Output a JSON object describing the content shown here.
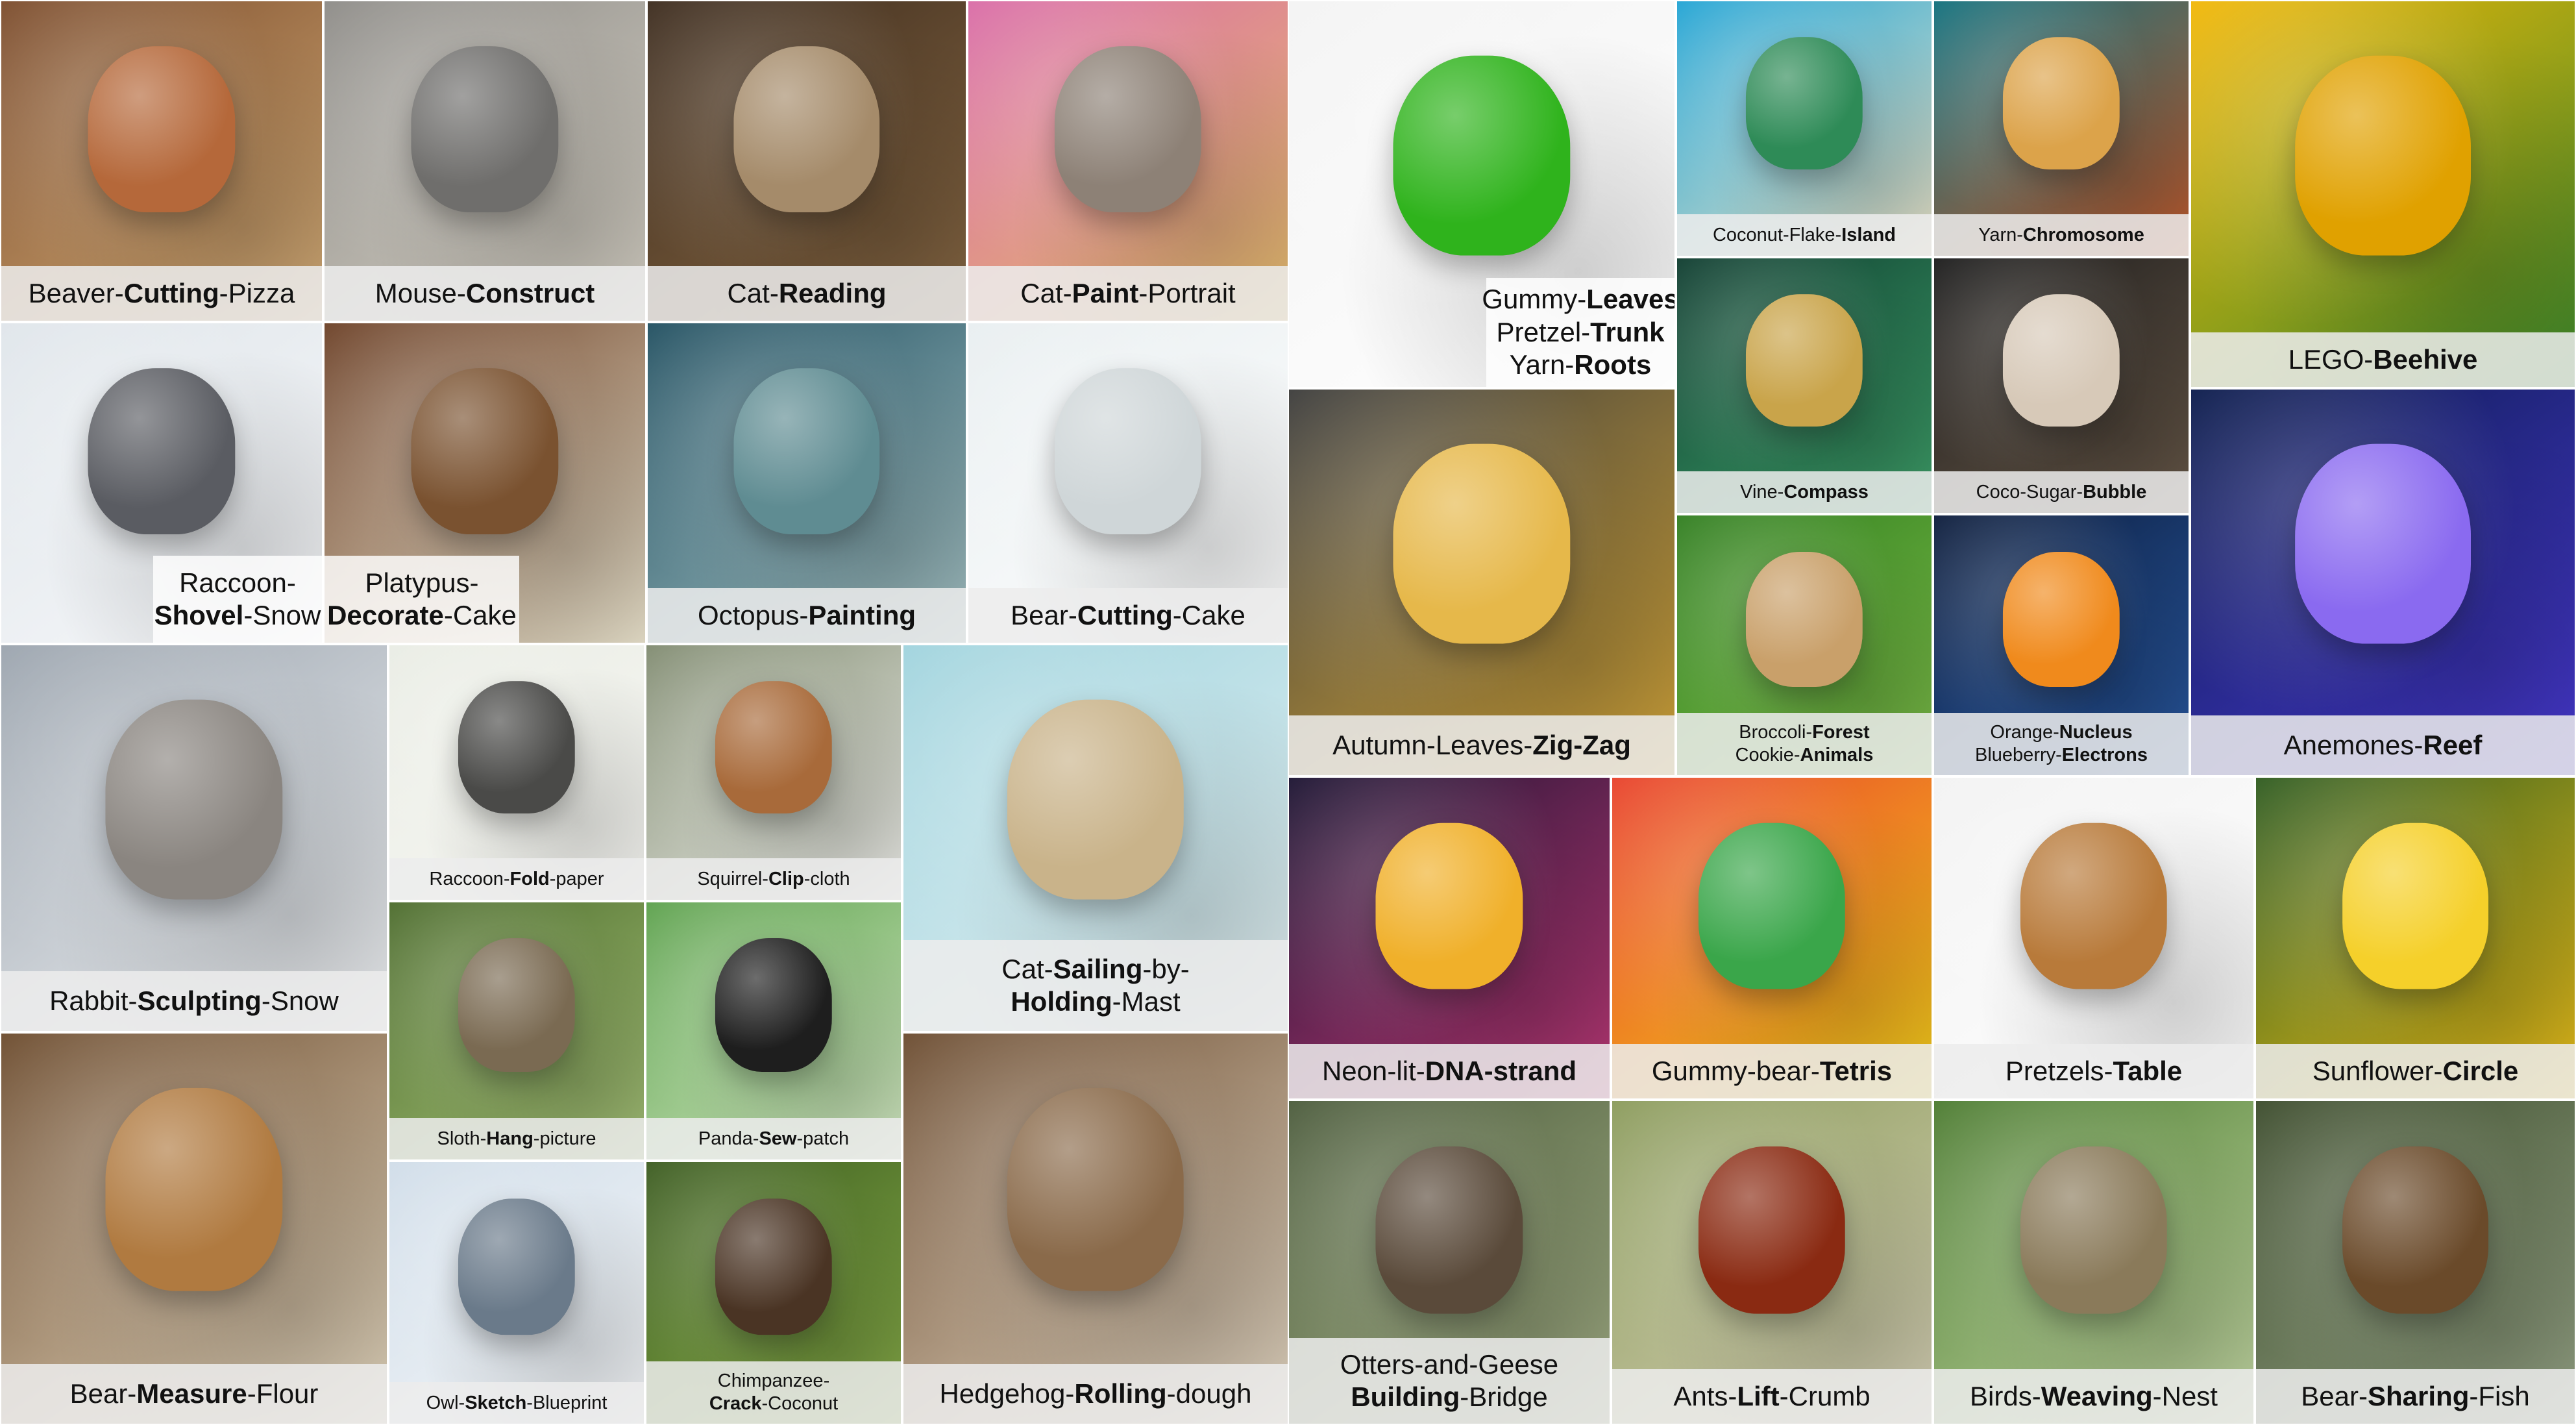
{
  "tiles": [
    {
      "id": "beaver",
      "lines": [
        [
          "Beaver-",
          ""
        ],
        [
          "Cutting",
          "b"
        ],
        [
          "-Pizza",
          ""
        ]
      ],
      "colors": [
        "#7a4a2a",
        "#d7b07a",
        "#b5683a"
      ]
    },
    {
      "id": "mouse",
      "lines": [
        [
          "Mouse-",
          ""
        ],
        [
          "Construct",
          "b"
        ]
      ],
      "colors": [
        "#8c8a86",
        "#d9d4c8",
        "#6f6e6c"
      ]
    },
    {
      "id": "cat-reading",
      "lines": [
        [
          "Cat-",
          ""
        ],
        [
          "Reading",
          "b"
        ]
      ],
      "colors": [
        "#3b2a1c",
        "#8a6a45",
        "#a58b6a"
      ]
    },
    {
      "id": "cat-paint",
      "lines": [
        [
          "Cat-",
          ""
        ],
        [
          "Paint",
          "b"
        ],
        [
          "-Portrait",
          ""
        ]
      ],
      "colors": [
        "#d96aa6",
        "#e7c16c",
        "#8d8176"
      ]
    },
    {
      "id": "gummy",
      "lines": [
        [
          "Gummy-",
          ""
        ],
        [
          "Leaves",
          "b"
        ],
        [
          "\n",
          ""
        ],
        [
          "Pretzel-",
          ""
        ],
        [
          "Trunk",
          "b"
        ],
        [
          "\n",
          ""
        ],
        [
          "Yarn-",
          ""
        ],
        [
          "Roots",
          "b"
        ]
      ],
      "colors": [
        "#f3f3f3",
        "#ffffff",
        "#2fb31c"
      ]
    },
    {
      "id": "coconut",
      "lines": [
        [
          "Coconut-Flake-",
          ""
        ],
        [
          "Island",
          "b"
        ]
      ],
      "colors": [
        "#1fa3d4",
        "#f1e6c8",
        "#2e8b57"
      ]
    },
    {
      "id": "yarn",
      "lines": [
        [
          "Yarn-",
          ""
        ],
        [
          "Chromosome",
          "b"
        ]
      ],
      "colors": [
        "#0f6f7c",
        "#c55a2b",
        "#dca34a"
      ]
    },
    {
      "id": "lego",
      "lines": [
        [
          "LEGO-",
          ""
        ],
        [
          "Beehive",
          "b"
        ]
      ],
      "colors": [
        "#f2b705",
        "#3a8a2c",
        "#e0a100"
      ]
    },
    {
      "id": "raccoon-shovel",
      "lines": [
        [
          "Raccoon-",
          ""
        ],
        [
          "\n",
          ""
        ],
        [
          "Shovel",
          "b"
        ],
        [
          "-Snow",
          ""
        ]
      ],
      "colors": [
        "#dfe5ea",
        "#f7f8fa",
        "#5a5c62"
      ]
    },
    {
      "id": "platypus",
      "lines": [
        [
          "Platypus-",
          ""
        ],
        [
          "\n",
          ""
        ],
        [
          "Decorate",
          "b"
        ],
        [
          "-Cake",
          ""
        ]
      ],
      "colors": [
        "#6b3f25",
        "#e9e2cc",
        "#7a5230"
      ]
    },
    {
      "id": "octopus",
      "lines": [
        [
          "Octopus-",
          ""
        ],
        [
          "Painting",
          "b"
        ]
      ],
      "colors": [
        "#1f4e5f",
        "#a9c6c8",
        "#5f8c92"
      ]
    },
    {
      "id": "bear-cake",
      "lines": [
        [
          "Bear-",
          ""
        ],
        [
          "Cutting",
          "b"
        ],
        [
          "-Cake",
          ""
        ]
      ],
      "colors": [
        "#e8eef0",
        "#ffffff",
        "#cfd6d8"
      ]
    },
    {
      "id": "vine",
      "lines": [
        [
          "Vine-",
          ""
        ],
        [
          "Compass",
          "b"
        ]
      ],
      "colors": [
        "#0d3b2e",
        "#3fa36b",
        "#c9a44a"
      ]
    },
    {
      "id": "coco",
      "lines": [
        [
          "Coco-Sugar-",
          ""
        ],
        [
          "Bubble",
          "b"
        ]
      ],
      "colors": [
        "#1a1a1a",
        "#6a5a4a",
        "#d7c9b8"
      ]
    },
    {
      "id": "autumn",
      "lines": [
        [
          "Autumn-Leaves-",
          ""
        ],
        [
          "Zig-Zag",
          "b"
        ]
      ],
      "colors": [
        "#3b3b3a",
        "#d8a93a",
        "#e6b84a"
      ]
    },
    {
      "id": "broccoli",
      "lines": [
        [
          "Broccoli-",
          ""
        ],
        [
          "Forest",
          "b"
        ],
        [
          "\n",
          ""
        ],
        [
          "Cookie-",
          ""
        ],
        [
          "Animals",
          "b"
        ]
      ],
      "colors": [
        "#2f7d1e",
        "#7fc04a",
        "#c9a06a"
      ]
    },
    {
      "id": "orange",
      "lines": [
        [
          "Orange-",
          ""
        ],
        [
          "Nucleus",
          "b"
        ],
        [
          "\n",
          ""
        ],
        [
          "Blueberry-",
          ""
        ],
        [
          "Electrons",
          "b"
        ]
      ],
      "colors": [
        "#0b1b3a",
        "#2a5ca8",
        "#f08a1c"
      ]
    },
    {
      "id": "anemones",
      "lines": [
        [
          "Anemones-",
          ""
        ],
        [
          "Reef",
          "b"
        ]
      ],
      "colors": [
        "#0a1a4a",
        "#4a3ad8",
        "#8a6af0"
      ]
    },
    {
      "id": "rabbit",
      "lines": [
        [
          "Rabbit-",
          ""
        ],
        [
          "Sculpting",
          "b"
        ],
        [
          "-Snow",
          ""
        ]
      ],
      "colors": [
        "#9aa3ad",
        "#f2f4f6",
        "#8a8580"
      ]
    },
    {
      "id": "raccoon-fold",
      "lines": [
        [
          "Raccoon-",
          ""
        ],
        [
          "Fold",
          "b"
        ],
        [
          "-paper",
          ""
        ]
      ],
      "colors": [
        "#e9ece4",
        "#f8f8f4",
        "#4a4a48"
      ]
    },
    {
      "id": "squirrel",
      "lines": [
        [
          "Squirrel-",
          ""
        ],
        [
          "Clip",
          "b"
        ],
        [
          "-cloth",
          ""
        ]
      ],
      "colors": [
        "#7f8a6f",
        "#f2f2ee",
        "#a86a3a"
      ]
    },
    {
      "id": "cat-sailing",
      "lines": [
        [
          "Cat-",
          ""
        ],
        [
          "Sailing",
          "b"
        ],
        [
          "-by-",
          ""
        ],
        [
          "\n",
          ""
        ],
        [
          "Holding",
          "b"
        ],
        [
          "-Mast",
          ""
        ]
      ],
      "colors": [
        "#9fd3dd",
        "#e6f2f4",
        "#c9b38a"
      ]
    },
    {
      "id": "dna",
      "lines": [
        [
          "Neon-lit-",
          ""
        ],
        [
          "DNA-strand",
          "b"
        ]
      ],
      "colors": [
        "#1a1230",
        "#c23a7a",
        "#f0b02a"
      ]
    },
    {
      "id": "gummy-tetris",
      "lines": [
        [
          "Gummy-bear-",
          ""
        ],
        [
          "Tetris",
          "b"
        ]
      ],
      "colors": [
        "#e8402a",
        "#f5d21a",
        "#3aa64a"
      ]
    },
    {
      "id": "pretzels",
      "lines": [
        [
          "Pretzels-",
          ""
        ],
        [
          "Table",
          "b"
        ]
      ],
      "colors": [
        "#f2f2f2",
        "#ffffff",
        "#b87a3a"
      ]
    },
    {
      "id": "sunflower",
      "lines": [
        [
          "Sunflower-",
          ""
        ],
        [
          "Circle",
          "b"
        ]
      ],
      "colors": [
        "#2d5a1e",
        "#f2c41a",
        "#f5d02a"
      ]
    },
    {
      "id": "sloth",
      "lines": [
        [
          "Sloth-",
          ""
        ],
        [
          "Hang",
          "b"
        ],
        [
          "-picture",
          ""
        ]
      ],
      "colors": [
        "#4a6a2a",
        "#a8c47a",
        "#7a6a52"
      ]
    },
    {
      "id": "panda",
      "lines": [
        [
          "Panda-",
          ""
        ],
        [
          "Sew",
          "b"
        ],
        [
          "-patch",
          ""
        ]
      ],
      "colors": [
        "#5aa04a",
        "#d8ecc8",
        "#1e1e1e"
      ]
    },
    {
      "id": "bear-flour",
      "lines": [
        [
          "Bear-",
          ""
        ],
        [
          "Measure",
          "b"
        ],
        [
          "-Flour",
          ""
        ]
      ],
      "colors": [
        "#6b4a2c",
        "#e8dcc4",
        "#b07a40"
      ]
    },
    {
      "id": "owl",
      "lines": [
        [
          "Owl-",
          ""
        ],
        [
          "Sketch",
          "b"
        ],
        [
          "-Blueprint",
          ""
        ]
      ],
      "colors": [
        "#cfdce8",
        "#f6f8fa",
        "#6a7a8a"
      ]
    },
    {
      "id": "chimp",
      "lines": [
        [
          "Chimpanzee-",
          ""
        ],
        [
          "\n",
          ""
        ],
        [
          "Crack",
          "b"
        ],
        [
          "-Coconut",
          ""
        ]
      ],
      "colors": [
        "#3a5a1e",
        "#8ab04a",
        "#4a3424"
      ]
    },
    {
      "id": "hedgehog",
      "lines": [
        [
          "Hedgehog-",
          ""
        ],
        [
          "Rolling",
          "b"
        ],
        [
          "-dough",
          ""
        ]
      ],
      "colors": [
        "#6a4a2e",
        "#e8dcc8",
        "#8a6a4a"
      ]
    },
    {
      "id": "otters",
      "lines": [
        [
          "Otters-and-Geese",
          ""
        ],
        [
          "\n",
          ""
        ],
        [
          "Building",
          "b"
        ],
        [
          "-Bridge",
          ""
        ]
      ],
      "colors": [
        "#4a5a3a",
        "#a8b48a",
        "#5a4a3a"
      ]
    },
    {
      "id": "ants",
      "lines": [
        [
          "Ants-",
          ""
        ],
        [
          "Lift",
          "b"
        ],
        [
          "-Crumb",
          ""
        ]
      ],
      "colors": [
        "#8a9a5a",
        "#d8d2b8",
        "#8a2a12"
      ]
    },
    {
      "id": "birds",
      "lines": [
        [
          "Birds-",
          ""
        ],
        [
          "Weaving",
          "b"
        ],
        [
          "-Nest",
          ""
        ]
      ],
      "colors": [
        "#4a7a2e",
        "#c8dca8",
        "#8a7a5a"
      ]
    },
    {
      "id": "bear-fish",
      "lines": [
        [
          "Bear-",
          ""
        ],
        [
          "Sharing",
          "b"
        ],
        [
          "-Fish",
          ""
        ]
      ],
      "colors": [
        "#3a4a2a",
        "#9aa88a",
        "#6a4a2a"
      ]
    }
  ]
}
